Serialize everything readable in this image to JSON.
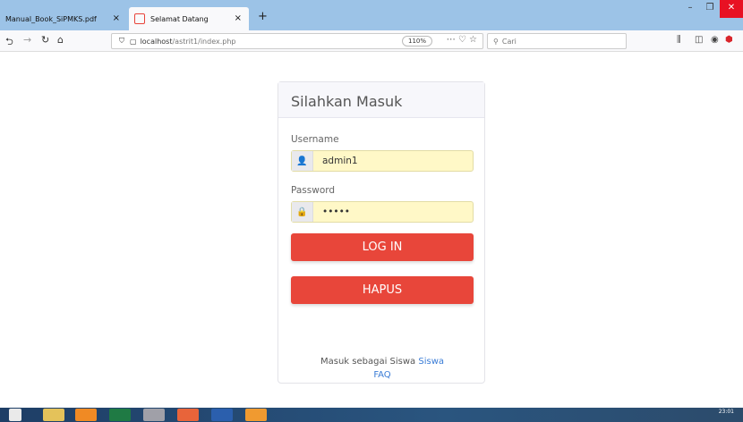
{
  "browser": {
    "tabs": [
      {
        "label": "Manual_Book_SiPMKS.pdf",
        "close": "×"
      },
      {
        "label": "Selamat Datang",
        "close": "×"
      }
    ],
    "new_tab": "+",
    "url_host": "localhost",
    "url_path": "/astrit1/index.php",
    "zoom": "110%",
    "search_placeholder": "Cari",
    "window_controls": [
      "–",
      "❐",
      "✕"
    ]
  },
  "login": {
    "title": "Silahkan Masuk",
    "username_label": "Username",
    "username_value": "admin1",
    "password_label": "Password",
    "password_value": "•••••",
    "login_button": "LOG IN",
    "clear_button": "HAPUS",
    "footer_text": "Masuk sebagai Siswa",
    "footer_link": "Siswa",
    "faq_link": "FAQ"
  },
  "taskbar": {
    "clock": "23:01"
  },
  "colors": {
    "accent": "#e8463a",
    "link": "#3a7cd6",
    "input_bg": "#fff8c7"
  }
}
